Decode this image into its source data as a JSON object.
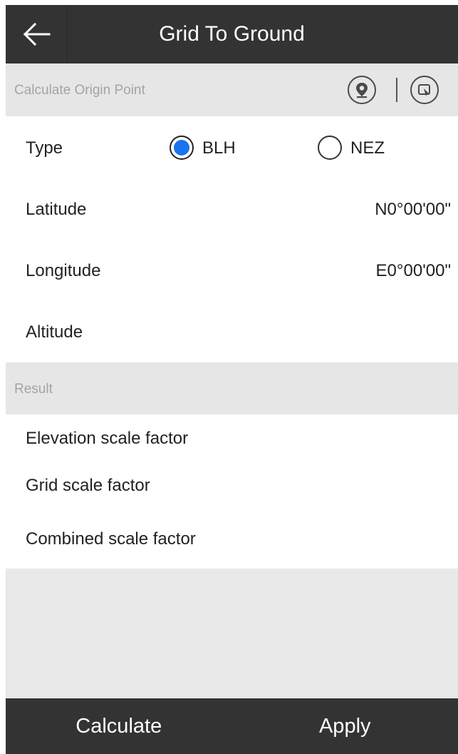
{
  "header": {
    "title": "Grid To Ground",
    "back_icon": "arrow-left-icon"
  },
  "origin_section": {
    "label": "Calculate Origin Point",
    "icons": [
      "location-pin-icon",
      "select-point-icon"
    ]
  },
  "type_row": {
    "label": "Type",
    "options": [
      {
        "label": "BLH",
        "selected": true
      },
      {
        "label": "NEZ",
        "selected": false
      }
    ],
    "accent": "#1a73ef"
  },
  "fields": {
    "latitude": {
      "label": "Latitude",
      "value": "N0°00'00\""
    },
    "longitude": {
      "label": "Longitude",
      "value": "E0°00'00\""
    },
    "altitude": {
      "label": "Altitude",
      "value": ""
    }
  },
  "result_section": {
    "label": "Result",
    "items": [
      {
        "label": "Elevation scale factor"
      },
      {
        "label": "Grid scale factor"
      },
      {
        "label": "Combined scale factor"
      }
    ]
  },
  "footer": {
    "calculate_label": "Calculate",
    "apply_label": "Apply"
  }
}
